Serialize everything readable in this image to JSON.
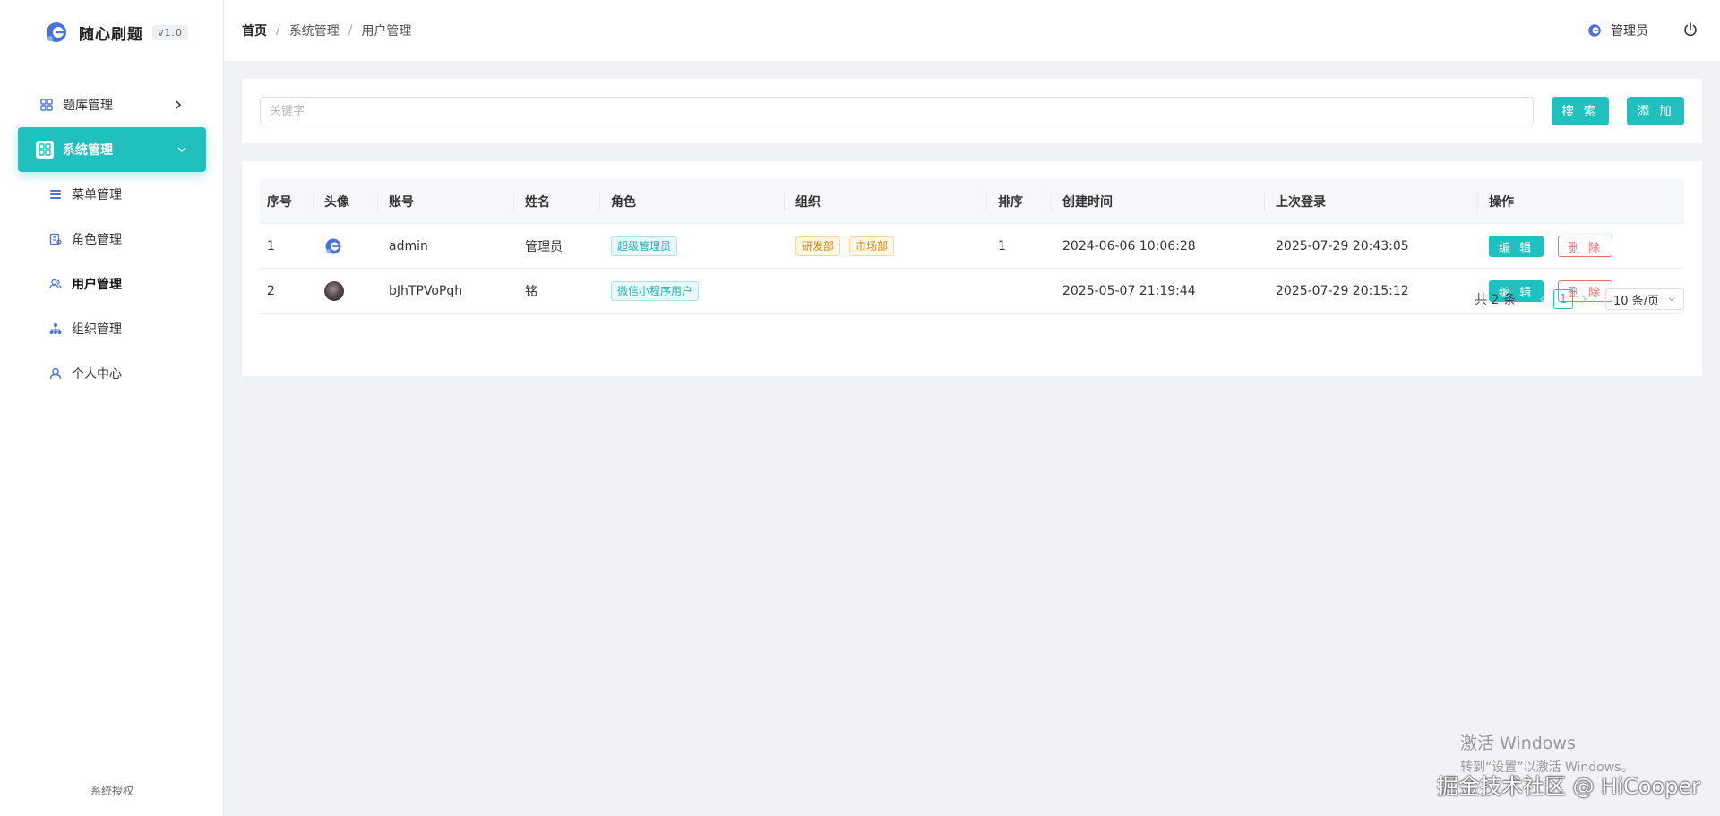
{
  "brand": {
    "name": "随心刷题",
    "version": "v1.0"
  },
  "sidebar": {
    "items": [
      {
        "label": "题库管理",
        "icon": "grid-icon"
      },
      {
        "label": "系统管理",
        "icon": "grid-icon",
        "active": true
      },
      {
        "label": "菜单管理",
        "icon": "menu-list-icon"
      },
      {
        "label": "角色管理",
        "icon": "role-icon"
      },
      {
        "label": "用户管理",
        "icon": "users-icon",
        "current": true
      },
      {
        "label": "组织管理",
        "icon": "org-tree-icon"
      },
      {
        "label": "个人中心",
        "icon": "person-icon"
      }
    ],
    "footer": "系统授权"
  },
  "header": {
    "breadcrumb": [
      "首页",
      "系统管理",
      "用户管理"
    ],
    "user": "管理员"
  },
  "search": {
    "placeholder": "关键字",
    "value": "",
    "search_label": "搜 索",
    "add_label": "添 加"
  },
  "table": {
    "columns": [
      "序号",
      "头像",
      "账号",
      "姓名",
      "角色",
      "组织",
      "排序",
      "创建时间",
      "上次登录",
      "操作"
    ],
    "rows": [
      {
        "idx": "1",
        "avatar": "logo",
        "account": "admin",
        "name": "管理员",
        "roles": [
          "超级管理员"
        ],
        "orgs": [
          "研发部",
          "市场部"
        ],
        "sort": "1",
        "created": "2024-06-06 10:06:28",
        "last_login": "2025-07-29 20:43:05"
      },
      {
        "idx": "2",
        "avatar": "photo",
        "account": "bJhTPVoPqh",
        "name": "铭",
        "roles": [
          "微信小程序用户"
        ],
        "orgs": [],
        "sort": "",
        "created": "2025-05-07 21:19:44",
        "last_login": "2025-07-29 20:15:12"
      }
    ],
    "edit_label": "编 辑",
    "delete_label": "删 除"
  },
  "pagination": {
    "total_text": "共 2 条",
    "current_page": "1",
    "page_size": "10 条/页"
  },
  "overlay": {
    "activate_title": "激活 Windows",
    "activate_sub": "转到“设置”以激活 Windows。",
    "community": "掘金技术社区 @ HiCooper"
  },
  "colors": {
    "accent": "#1fc0be",
    "danger": "#f56c6c",
    "org_tag": "#d48806"
  }
}
